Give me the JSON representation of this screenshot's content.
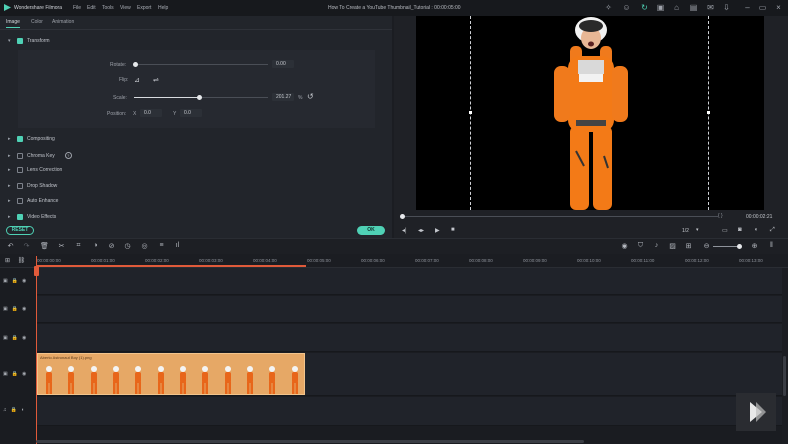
{
  "titlebar": {
    "app_name": "Wondershare Filmora",
    "menu": [
      "File",
      "Edit",
      "Tools",
      "View",
      "Export",
      "Help"
    ],
    "project_title": "How To Create a YouTube Thumbnail_Tutorial : 00:00:05:00"
  },
  "panel": {
    "tabs": [
      "Image",
      "Color",
      "Animation"
    ],
    "transform_label": "Transform",
    "rotate_label": "Rotate:",
    "rotate_value": "0.00",
    "flip_label": "Flip:",
    "scale_label": "Scale:",
    "scale_value": "201.27",
    "scale_unit": "%",
    "scale_fraction": 0.52,
    "position_label": "Position:",
    "pos_x_label": "X",
    "pos_x_value": "0.0",
    "pos_y_label": "Y",
    "pos_y_value": "0.0",
    "sections": [
      {
        "label": "Compositing",
        "checked": true
      },
      {
        "label": "Chroma Key",
        "checked": false
      },
      {
        "label": "Lens Correction",
        "checked": false
      },
      {
        "label": "Drop Shadow",
        "checked": false
      },
      {
        "label": "Auto Enhance",
        "checked": false
      },
      {
        "label": "Video Effects",
        "checked": true
      }
    ],
    "reset_label": "RESET",
    "ok_label": "OK"
  },
  "preview": {
    "timecode": "00:00:02:21",
    "quality": "1/2",
    "progress_fraction": 0.0
  },
  "timeline": {
    "ticks": [
      "00:00:00:00",
      "00:00:01:00",
      "00:00:02:00",
      "00:00:03:00",
      "00:00:04:00",
      "00:00:05:00",
      "00:00:06:00",
      "00:00:07:00",
      "00:00:08:00",
      "00:00:09:00",
      "00:00:10:00",
      "00:00:11:00",
      "00:00:12:00",
      "00:00:13:00"
    ],
    "clip_label": "Aberto Astronaut Boy (1).png"
  },
  "colors": {
    "accent": "#4fd1b5",
    "playhead": "#e05a3a",
    "clip": "#e6a866"
  }
}
